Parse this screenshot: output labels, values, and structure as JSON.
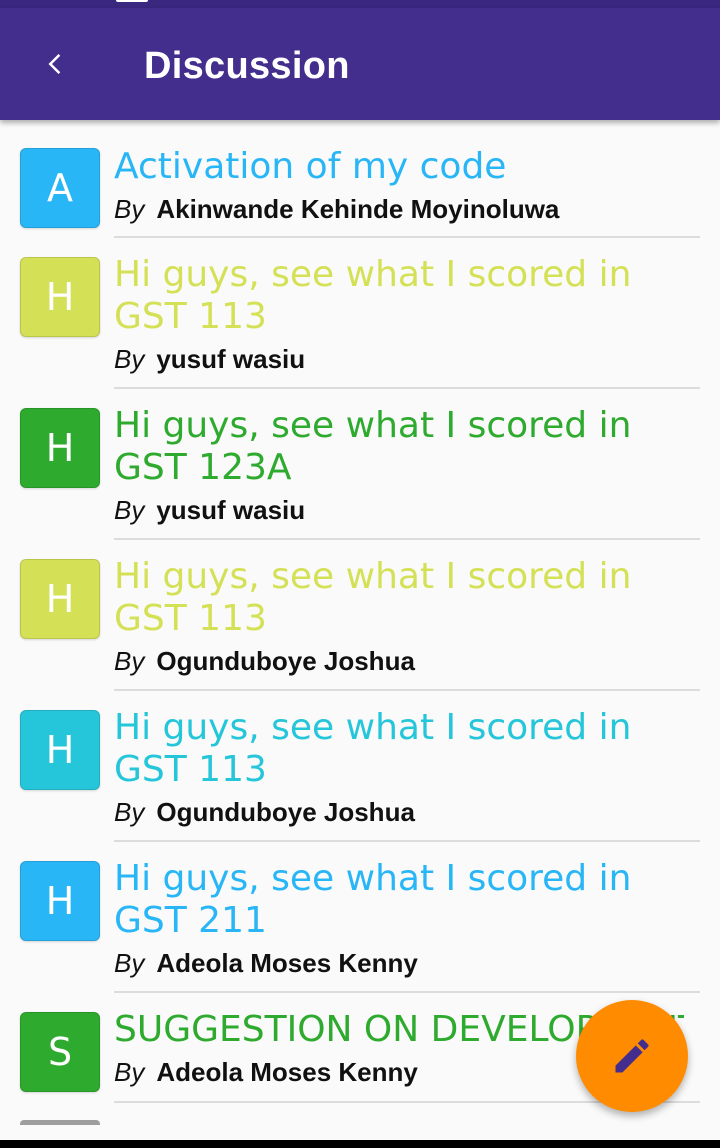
{
  "app_bar": {
    "title": "Discussion",
    "back_icon": "chevron-left-icon",
    "background_color": "#432e8e"
  },
  "by_label": "By",
  "threads": [
    {
      "initial": "A",
      "title": "Activation of my code",
      "author": "Akinwande  Kehinde Moyinoluwa",
      "avatar_color": "#29b6f6",
      "title_color": "#29b6f6"
    },
    {
      "initial": "H",
      "title": "Hi guys, see what I scored in GST 113",
      "author": "yusuf wasiu",
      "avatar_color": "#d4e157",
      "title_color": "#d4e157"
    },
    {
      "initial": "H",
      "title": "Hi guys, see what I scored in GST 123A",
      "author": "yusuf wasiu",
      "avatar_color": "#2eaa2e",
      "title_color": "#2eaa2e"
    },
    {
      "initial": "H",
      "title": "Hi guys, see what I scored in GST 113",
      "author": "Ogunduboye Joshua",
      "avatar_color": "#d4e157",
      "title_color": "#d4e157"
    },
    {
      "initial": "H",
      "title": "Hi guys, see what I scored in GST 113",
      "author": "Ogunduboye Joshua",
      "avatar_color": "#26c6da",
      "title_color": "#26c6da"
    },
    {
      "initial": "H",
      "title": "Hi guys, see what I scored in GST 211",
      "author": "Adeola  Moses Kenny",
      "avatar_color": "#29b6f6",
      "title_color": "#29b6f6"
    },
    {
      "initial": "S",
      "title": "SUGGESTION ON DEVELOPMENT",
      "author": "Adeola  Moses Kenny",
      "avatar_color": "#2eaa2e",
      "title_color": "#2eaa2e"
    }
  ],
  "fab": {
    "icon": "pencil-icon",
    "color": "#ff8c00",
    "icon_color": "#432e8e"
  }
}
